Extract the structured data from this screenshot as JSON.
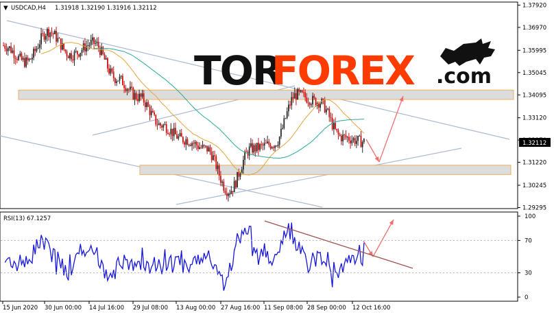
{
  "header": {
    "arrow_glyph": "▼",
    "symbol": "USDCAD,H4",
    "ohlc": "1.31918 1.32190 1.31916 1.32112"
  },
  "logo": {
    "part1": "TOR",
    "part2": "FOREX",
    "part3": ".com",
    "brand_color": "#ff3b00"
  },
  "price_axis": {
    "ticks": [
      "1.37920",
      "1.36970",
      "1.35995",
      "1.35045",
      "1.34095",
      "1.33120",
      "1.32170",
      "1.31220",
      "1.30245",
      "1.29295"
    ],
    "current_price": "1.32112"
  },
  "rsi": {
    "label": "RSI(13) 67.1257",
    "ticks": [
      "100",
      "70",
      "30",
      "0"
    ]
  },
  "time_axis": {
    "labels": [
      "15 Jun 2020",
      "30 Jun 00:00",
      "14 Jul 16:00",
      "29 Jul 08:00",
      "13 Aug 00:00",
      "27 Aug 16:00",
      "11 Sep 08:00",
      "28 Sep 00:00",
      "12 Oct 16:00"
    ]
  },
  "colors": {
    "bull": "#2b2b2b",
    "bear": "#cc1111",
    "ma_fast": "#e8a33a",
    "ma_slow": "#2aa89c",
    "rsi_line": "#1515dd",
    "trend_lines": "#aabbd0",
    "zone_fill": "#dcdcdc",
    "zone_border": "#f0b060",
    "forecast_arrow": "#f07070",
    "rsi_trend": "#a0524d"
  },
  "chart_data": {
    "type": "candlestick",
    "title": "USDCAD,H4",
    "ylim": [
      1.2925,
      1.3805
    ],
    "x_range": [
      "15 Jun 2020",
      "12 Oct 16:00"
    ],
    "price_path": [
      [
        "15 Jun 2020",
        1.362
      ],
      [
        "22 Jun 2020",
        1.355
      ],
      [
        "30 Jun 00:00",
        1.368
      ],
      [
        "07 Jul 2020",
        1.358
      ],
      [
        "14 Jul 16:00",
        1.363
      ],
      [
        "20 Jul 2020",
        1.348
      ],
      [
        "29 Jul 08:00",
        1.34
      ],
      [
        "05 Aug 2020",
        1.328
      ],
      [
        "13 Aug 00:00",
        1.322
      ],
      [
        "20 Aug 2020",
        1.318
      ],
      [
        "27 Aug 16:00",
        1.3
      ],
      [
        "04 Sep 2020",
        1.318
      ],
      [
        "11 Sep 08:00",
        1.32
      ],
      [
        "22 Sep 2020",
        1.341
      ],
      [
        "28 Sep 00:00",
        1.338
      ],
      [
        "05 Oct 2020",
        1.323
      ],
      [
        "12 Oct 16:00",
        1.321
      ]
    ],
    "support_zone": [
      1.307,
      1.311
    ],
    "resistance_zone": [
      1.339,
      1.343
    ],
    "last_price": 1.32112,
    "rsi_value": 67.1257,
    "rsi_levels": [
      70,
      30
    ],
    "rsi_range": [
      0,
      100
    ]
  }
}
